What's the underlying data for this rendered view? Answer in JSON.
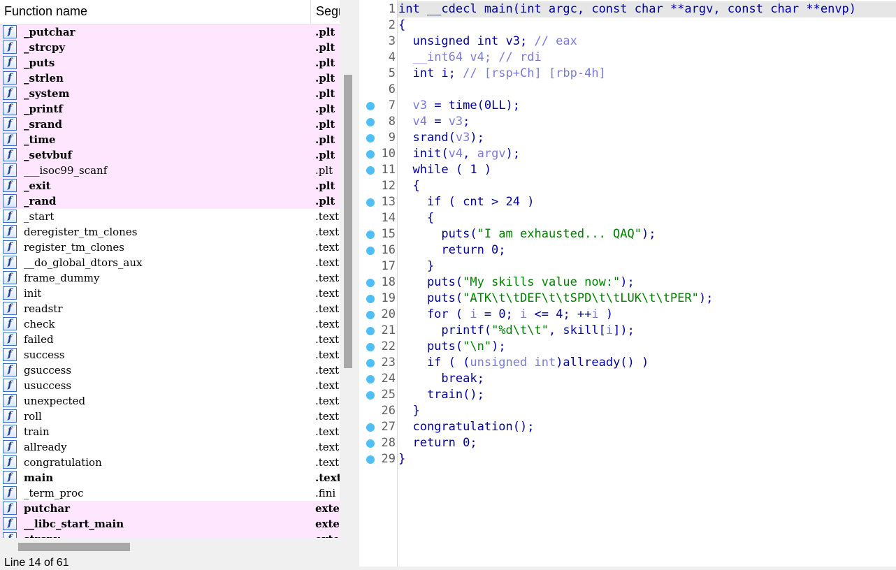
{
  "functions_panel": {
    "col_name": "Function name",
    "col_segment": "Segment",
    "icon_glyph": "f",
    "items": [
      {
        "name": "_putchar",
        "segment": ".plt",
        "ext": true,
        "bold": true
      },
      {
        "name": "_strcpy",
        "segment": ".plt",
        "ext": true,
        "bold": true
      },
      {
        "name": "_puts",
        "segment": ".plt",
        "ext": true,
        "bold": true
      },
      {
        "name": "_strlen",
        "segment": ".plt",
        "ext": true,
        "bold": true
      },
      {
        "name": "_system",
        "segment": ".plt",
        "ext": true,
        "bold": true
      },
      {
        "name": "_printf",
        "segment": ".plt",
        "ext": true,
        "bold": true
      },
      {
        "name": "_srand",
        "segment": ".plt",
        "ext": true,
        "bold": true
      },
      {
        "name": "_time",
        "segment": ".plt",
        "ext": true,
        "bold": true
      },
      {
        "name": "_setvbuf",
        "segment": ".plt",
        "ext": true,
        "bold": true
      },
      {
        "name": "___isoc99_scanf",
        "segment": ".plt",
        "ext": true,
        "bold": false
      },
      {
        "name": "_exit",
        "segment": ".plt",
        "ext": true,
        "bold": true
      },
      {
        "name": "_rand",
        "segment": ".plt",
        "ext": true,
        "bold": true
      },
      {
        "name": "_start",
        "segment": ".text",
        "ext": false,
        "bold": false
      },
      {
        "name": "deregister_tm_clones",
        "segment": ".text",
        "ext": false,
        "bold": false
      },
      {
        "name": "register_tm_clones",
        "segment": ".text",
        "ext": false,
        "bold": false
      },
      {
        "name": "__do_global_dtors_aux",
        "segment": ".text",
        "ext": false,
        "bold": false
      },
      {
        "name": "frame_dummy",
        "segment": ".text",
        "ext": false,
        "bold": false
      },
      {
        "name": "init",
        "segment": ".text",
        "ext": false,
        "bold": false
      },
      {
        "name": "readstr",
        "segment": ".text",
        "ext": false,
        "bold": false
      },
      {
        "name": "check",
        "segment": ".text",
        "ext": false,
        "bold": false
      },
      {
        "name": "failed",
        "segment": ".text",
        "ext": false,
        "bold": false
      },
      {
        "name": "success",
        "segment": ".text",
        "ext": false,
        "bold": false
      },
      {
        "name": "gsuccess",
        "segment": ".text",
        "ext": false,
        "bold": false
      },
      {
        "name": "usuccess",
        "segment": ".text",
        "ext": false,
        "bold": false
      },
      {
        "name": "unexpected",
        "segment": ".text",
        "ext": false,
        "bold": false
      },
      {
        "name": "roll",
        "segment": ".text",
        "ext": false,
        "bold": false
      },
      {
        "name": "train",
        "segment": ".text",
        "ext": false,
        "bold": false
      },
      {
        "name": "allready",
        "segment": ".text",
        "ext": false,
        "bold": false
      },
      {
        "name": "congratulation",
        "segment": ".text",
        "ext": false,
        "bold": false
      },
      {
        "name": "main",
        "segment": ".text",
        "ext": false,
        "bold": true
      },
      {
        "name": "_term_proc",
        "segment": ".fini",
        "ext": false,
        "bold": false
      },
      {
        "name": "putchar",
        "segment": "extern",
        "ext": true,
        "bold": true
      },
      {
        "name": "__libc_start_main",
        "segment": "extern",
        "ext": true,
        "bold": true
      },
      {
        "name": "strcpy",
        "segment": "extern",
        "ext": true,
        "bold": true
      }
    ],
    "vscroll_fraction": 0.23,
    "status": "Line 14 of 61"
  },
  "pseudocode": {
    "breakpoint_color": "#4fbff7",
    "lines": [
      {
        "n": "1",
        "bp": false,
        "tokens": [
          [
            "k",
            "int __cdecl main(int argc, const char **argv, const char **envp)"
          ]
        ]
      },
      {
        "n": "2",
        "bp": false,
        "tokens": [
          [
            "k",
            "{"
          ]
        ]
      },
      {
        "n": "3",
        "bp": false,
        "tokens": [
          [
            "k",
            "  unsigned int v3; "
          ],
          [
            "c",
            "// eax"
          ]
        ]
      },
      {
        "n": "4",
        "bp": false,
        "tokens": [
          [
            "k",
            "  "
          ],
          [
            "c",
            "__int64 v4; // rdi"
          ]
        ]
      },
      {
        "n": "5",
        "bp": false,
        "tokens": [
          [
            "k",
            "  int i; "
          ],
          [
            "c",
            "// [rsp+Ch] [rbp-4h]"
          ]
        ]
      },
      {
        "n": "6",
        "bp": false,
        "tokens": []
      },
      {
        "n": "7",
        "bp": true,
        "tokens": [
          [
            "k",
            "  "
          ],
          [
            "v",
            "v3"
          ],
          [
            "k",
            " = time(0LL);"
          ]
        ]
      },
      {
        "n": "8",
        "bp": true,
        "tokens": [
          [
            "k",
            "  "
          ],
          [
            "v",
            "v4"
          ],
          [
            "k",
            " = "
          ],
          [
            "v",
            "v3"
          ],
          [
            "k",
            ";"
          ]
        ]
      },
      {
        "n": "9",
        "bp": true,
        "tokens": [
          [
            "k",
            "  srand("
          ],
          [
            "v",
            "v3"
          ],
          [
            "k",
            ");"
          ]
        ]
      },
      {
        "n": "10",
        "bp": true,
        "tokens": [
          [
            "k",
            "  init("
          ],
          [
            "v",
            "v4"
          ],
          [
            "k",
            ", "
          ],
          [
            "v",
            "argv"
          ],
          [
            "k",
            ");"
          ]
        ]
      },
      {
        "n": "11",
        "bp": true,
        "tokens": [
          [
            "k",
            "  while ( 1 )"
          ]
        ]
      },
      {
        "n": "12",
        "bp": false,
        "tokens": [
          [
            "k",
            "  {"
          ]
        ]
      },
      {
        "n": "13",
        "bp": true,
        "tokens": [
          [
            "k",
            "    if ( cnt > 24 )"
          ]
        ]
      },
      {
        "n": "14",
        "bp": false,
        "tokens": [
          [
            "k",
            "    {"
          ]
        ]
      },
      {
        "n": "15",
        "bp": true,
        "tokens": [
          [
            "k",
            "      puts("
          ],
          [
            "s",
            "\"I am exhausted... QAQ\""
          ],
          [
            "k",
            ");"
          ]
        ]
      },
      {
        "n": "16",
        "bp": true,
        "tokens": [
          [
            "k",
            "      return 0;"
          ]
        ]
      },
      {
        "n": "17",
        "bp": false,
        "tokens": [
          [
            "k",
            "    }"
          ]
        ]
      },
      {
        "n": "18",
        "bp": true,
        "tokens": [
          [
            "k",
            "    puts("
          ],
          [
            "s",
            "\"My skills value now:\""
          ],
          [
            "k",
            ");"
          ]
        ]
      },
      {
        "n": "19",
        "bp": true,
        "tokens": [
          [
            "k",
            "    puts("
          ],
          [
            "s",
            "\"ATK\\t\\tDEF\\t\\tSPD\\t\\tLUK\\t\\tPER\""
          ],
          [
            "k",
            ");"
          ]
        ]
      },
      {
        "n": "20",
        "bp": true,
        "tokens": [
          [
            "k",
            "    for ( "
          ],
          [
            "v",
            "i"
          ],
          [
            "k",
            " = 0; "
          ],
          [
            "v",
            "i"
          ],
          [
            "k",
            " <= 4; ++"
          ],
          [
            "v",
            "i"
          ],
          [
            "k",
            " )"
          ]
        ]
      },
      {
        "n": "21",
        "bp": true,
        "tokens": [
          [
            "k",
            "      printf("
          ],
          [
            "s",
            "\"%d\\t\\t\""
          ],
          [
            "k",
            ", skill["
          ],
          [
            "v",
            "i"
          ],
          [
            "k",
            "]);"
          ]
        ]
      },
      {
        "n": "22",
        "bp": true,
        "tokens": [
          [
            "k",
            "    puts("
          ],
          [
            "s",
            "\"\\n\""
          ],
          [
            "k",
            ");"
          ]
        ]
      },
      {
        "n": "23",
        "bp": true,
        "tokens": [
          [
            "k",
            "    if ( ("
          ],
          [
            "c",
            "unsigned int"
          ],
          [
            "k",
            ")allready() )"
          ]
        ]
      },
      {
        "n": "24",
        "bp": true,
        "tokens": [
          [
            "k",
            "      break;"
          ]
        ]
      },
      {
        "n": "25",
        "bp": true,
        "tokens": [
          [
            "k",
            "    train();"
          ]
        ]
      },
      {
        "n": "26",
        "bp": false,
        "tokens": [
          [
            "k",
            "  }"
          ]
        ]
      },
      {
        "n": "27",
        "bp": true,
        "tokens": [
          [
            "k",
            "  congratulation();"
          ]
        ]
      },
      {
        "n": "28",
        "bp": true,
        "tokens": [
          [
            "k",
            "  return 0;"
          ]
        ]
      },
      {
        "n": "29",
        "bp": true,
        "tokens": [
          [
            "k",
            "}"
          ]
        ]
      }
    ]
  }
}
